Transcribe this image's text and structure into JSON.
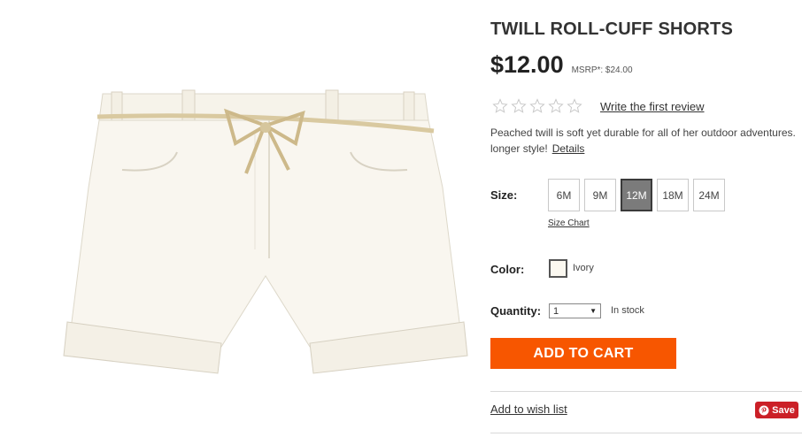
{
  "product": {
    "title": "TWILL ROLL-CUFF SHORTS",
    "price": "$12.00",
    "msrp": "MSRP*: $24.00",
    "image_icon": "shorts-product-image"
  },
  "rating": {
    "stars_filled": 0,
    "stars_total": 5,
    "review_link": "Write the first review"
  },
  "description": {
    "line1": "Peached twill is soft yet durable for all of her outdoor adventures.",
    "line2": "longer style!",
    "details_link": "Details"
  },
  "size": {
    "label": "Size:",
    "options": [
      "6M",
      "9M",
      "12M",
      "18M",
      "24M"
    ],
    "selected": "12M",
    "size_chart_link": "Size Chart"
  },
  "color": {
    "label": "Color:",
    "selected_name": "Ivory",
    "swatch_color": "#fbf8f0"
  },
  "quantity": {
    "label": "Quantity:",
    "value": "1",
    "stock_status": "In stock"
  },
  "actions": {
    "add_to_cart": "ADD TO CART",
    "add_to_cart_color": "#f75600",
    "wishlist": "Add to wish list",
    "pinterest_save": "Save",
    "pinterest_color": "#cb2027"
  }
}
